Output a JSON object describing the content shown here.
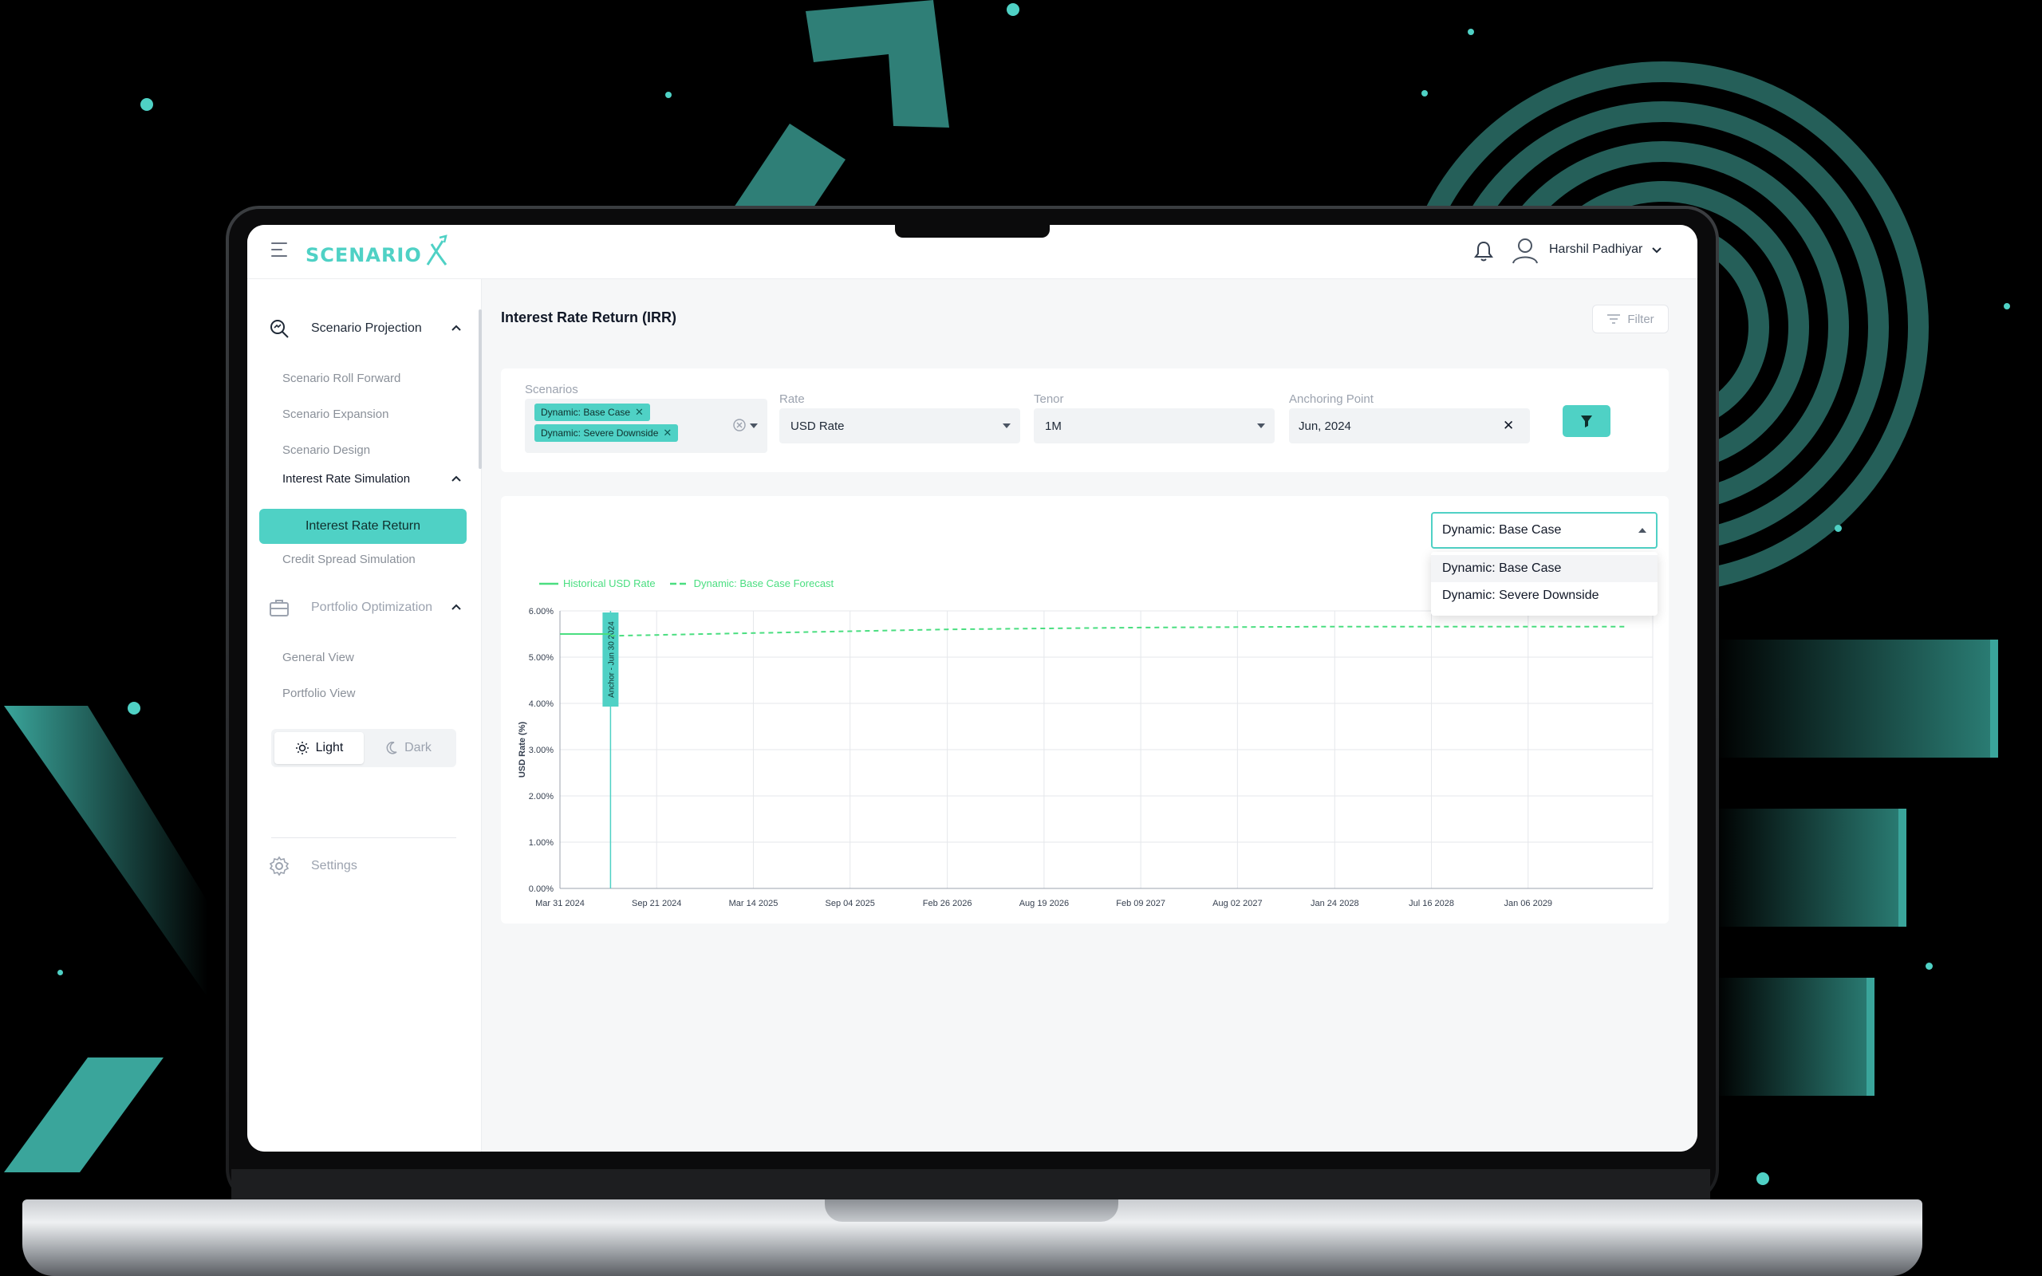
{
  "app": {
    "logo": "SCENARIO"
  },
  "header": {
    "user_name": "Harshil Padhiyar"
  },
  "sidebar": {
    "group1": "Scenario Projection",
    "items1": [
      "Scenario Roll Forward",
      "Scenario Expansion",
      "Scenario Design"
    ],
    "sub_group": "Interest Rate Simulation",
    "active_item": "Interest Rate Return",
    "item_after": "Credit Spread Simulation",
    "group2": "Portfolio Optimization",
    "items2": [
      "General View",
      "Portfolio View"
    ],
    "theme_light": "Light",
    "theme_dark": "Dark",
    "settings": "Settings"
  },
  "page": {
    "title": "Interest Rate Return (IRR)",
    "filter_label": "Filter"
  },
  "filters": {
    "scenarios_label": "Scenarios",
    "scenario_chips": [
      "Dynamic: Base Case",
      "Dynamic: Severe Downside"
    ],
    "rate_label": "Rate",
    "rate_value": "USD Rate",
    "tenor_label": "Tenor",
    "tenor_value": "1M",
    "anchor_label": "Anchoring Point",
    "anchor_value": "Jun, 2024"
  },
  "scenario_select": {
    "value": "Dynamic: Base Case",
    "options": [
      "Dynamic: Base Case",
      "Dynamic: Severe Downside"
    ]
  },
  "colors": {
    "accent": "#4fd1c5",
    "line": "#4ade80"
  },
  "chart_data": {
    "type": "line",
    "title": "",
    "xlabel": "",
    "ylabel": "USD Rate (%)",
    "ylim": [
      0,
      6
    ],
    "y_ticks": [
      "0.00%",
      "1.00%",
      "2.00%",
      "3.00%",
      "4.00%",
      "5.00%",
      "6.00%"
    ],
    "x_ticks": [
      "Mar 31 2024",
      "Sep 21 2024",
      "Mar 14 2025",
      "Sep 04 2025",
      "Feb 26 2026",
      "Aug 19 2026",
      "Feb 09 2027",
      "Aug 02 2027",
      "Jan 24 2028",
      "Jul 16 2028",
      "Jan 06 2029"
    ],
    "legend_position": "top-left",
    "grid": true,
    "anchor_label": "Anchor - Jun 30 2024",
    "series": [
      {
        "name": "Historical USD Rate",
        "style": "solid",
        "x": [
          "2024-03-31",
          "2024-06-30"
        ],
        "y": [
          5.5,
          5.5
        ]
      },
      {
        "name": "Dynamic: Base Case Forecast",
        "style": "dashed",
        "x": [
          "2024-06-30",
          "2024-09-21",
          "2025-03-14",
          "2025-09-04",
          "2026-02-26",
          "2026-08-19",
          "2027-02-09",
          "2027-08-02",
          "2028-01-24",
          "2028-07-16",
          "2029-01-06",
          "2029-06-30"
        ],
        "y": [
          5.46,
          5.48,
          5.52,
          5.56,
          5.6,
          5.62,
          5.64,
          5.65,
          5.66,
          5.66,
          5.66,
          5.66
        ]
      }
    ]
  }
}
